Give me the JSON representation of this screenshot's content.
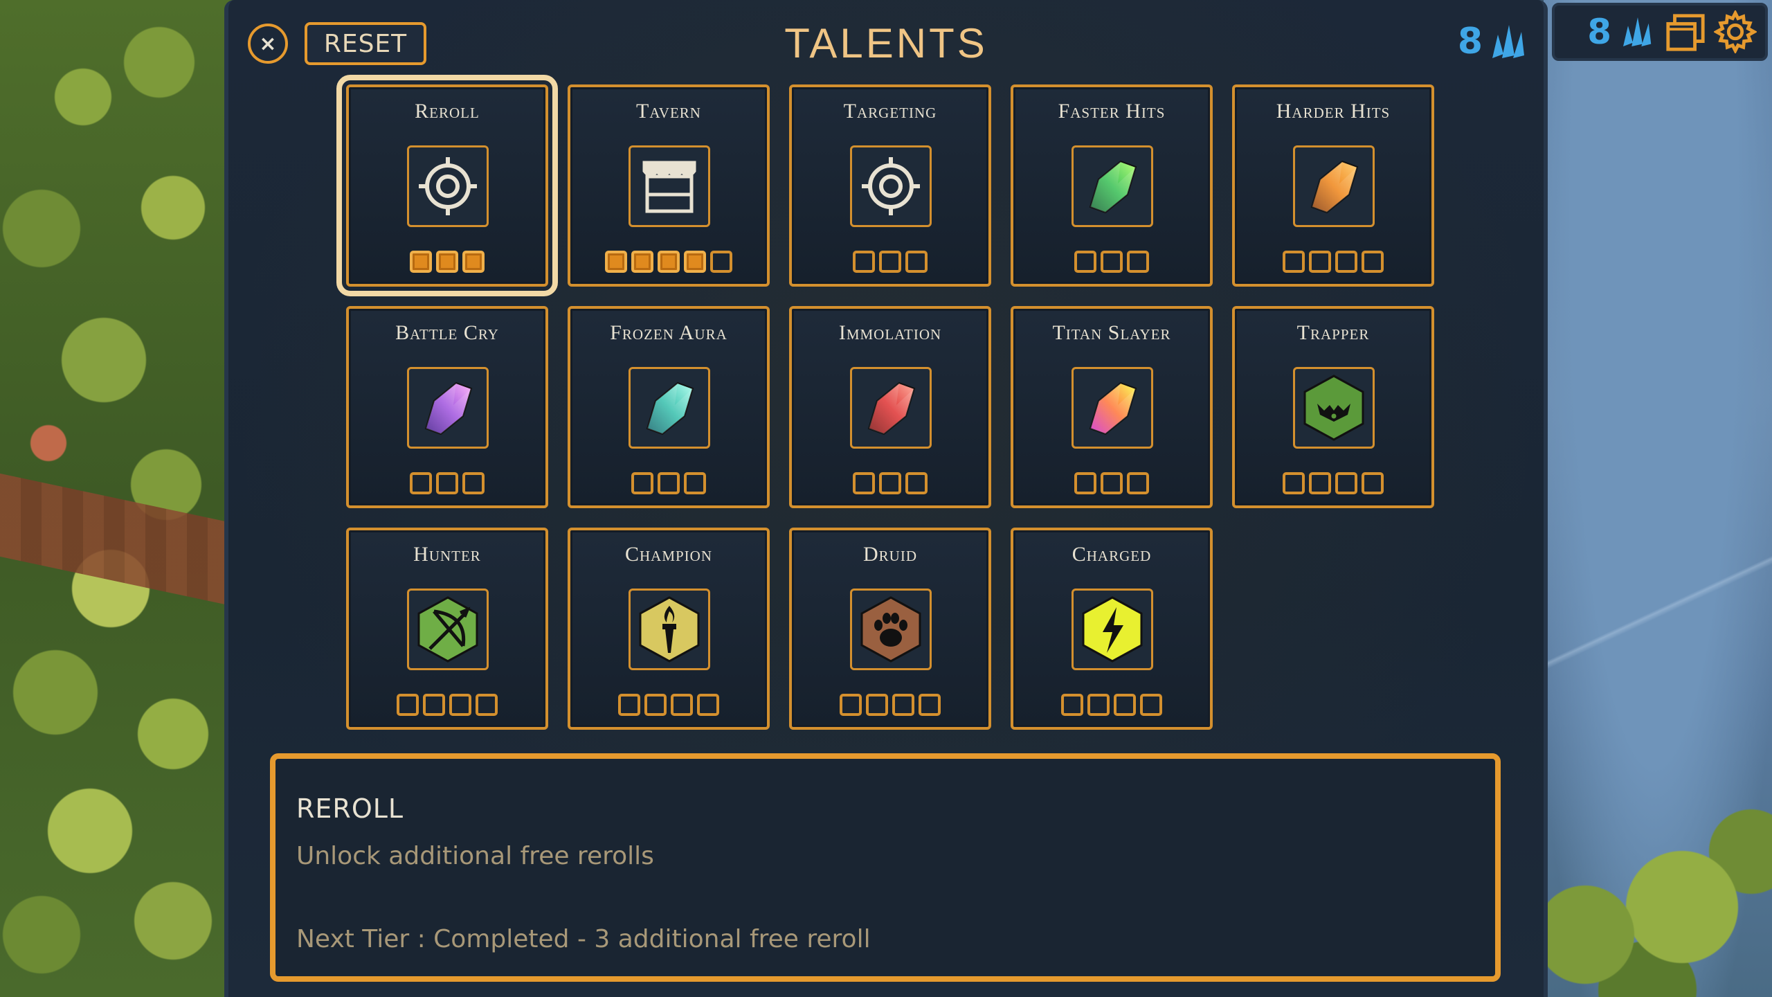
{
  "title": "TALENTS",
  "toolbar": {
    "close_label": "×",
    "reset_label": "RESET"
  },
  "points": {
    "count": "8"
  },
  "hud": {
    "count": "8"
  },
  "talents": [
    {
      "name": "Reroll",
      "icon": "target-icon",
      "tiers": 3,
      "filled": 3,
      "selected": true
    },
    {
      "name": "Tavern",
      "icon": "tavern-icon",
      "tiers": 5,
      "filled": 4
    },
    {
      "name": "Targeting",
      "icon": "target-icon",
      "tiers": 3,
      "filled": 0
    },
    {
      "name": "Faster Hits",
      "icon": "green-crystal-icon",
      "tiers": 3,
      "filled": 0
    },
    {
      "name": "Harder Hits",
      "icon": "orange-crystal-icon",
      "tiers": 4,
      "filled": 0
    },
    {
      "name": "Battle Cry",
      "icon": "purple-crystal-icon",
      "tiers": 3,
      "filled": 0
    },
    {
      "name": "Frozen Aura",
      "icon": "teal-crystal-icon",
      "tiers": 3,
      "filled": 0
    },
    {
      "name": "Immolation",
      "icon": "red-crystal-icon",
      "tiers": 3,
      "filled": 0
    },
    {
      "name": "Titan Slayer",
      "icon": "rainbow-crystal-icon",
      "tiers": 3,
      "filled": 0
    },
    {
      "name": "Trapper",
      "icon": "trap-icon",
      "tiers": 4,
      "filled": 0
    },
    {
      "name": "Hunter",
      "icon": "bow-icon",
      "tiers": 4,
      "filled": 0
    },
    {
      "name": "Champion",
      "icon": "torch-icon",
      "tiers": 4,
      "filled": 0
    },
    {
      "name": "Druid",
      "icon": "paw-icon",
      "tiers": 4,
      "filled": 0
    },
    {
      "name": "Charged",
      "icon": "lightning-icon",
      "tiers": 4,
      "filled": 0
    }
  ],
  "description": {
    "title": "REROLL",
    "text": "Unlock additional free rerolls",
    "next_tier": "Next Tier : Completed - 3 additional free reroll"
  },
  "colors": {
    "accent": "#e69a2e",
    "points": "#3fa6e6",
    "title": "#f0c585"
  }
}
